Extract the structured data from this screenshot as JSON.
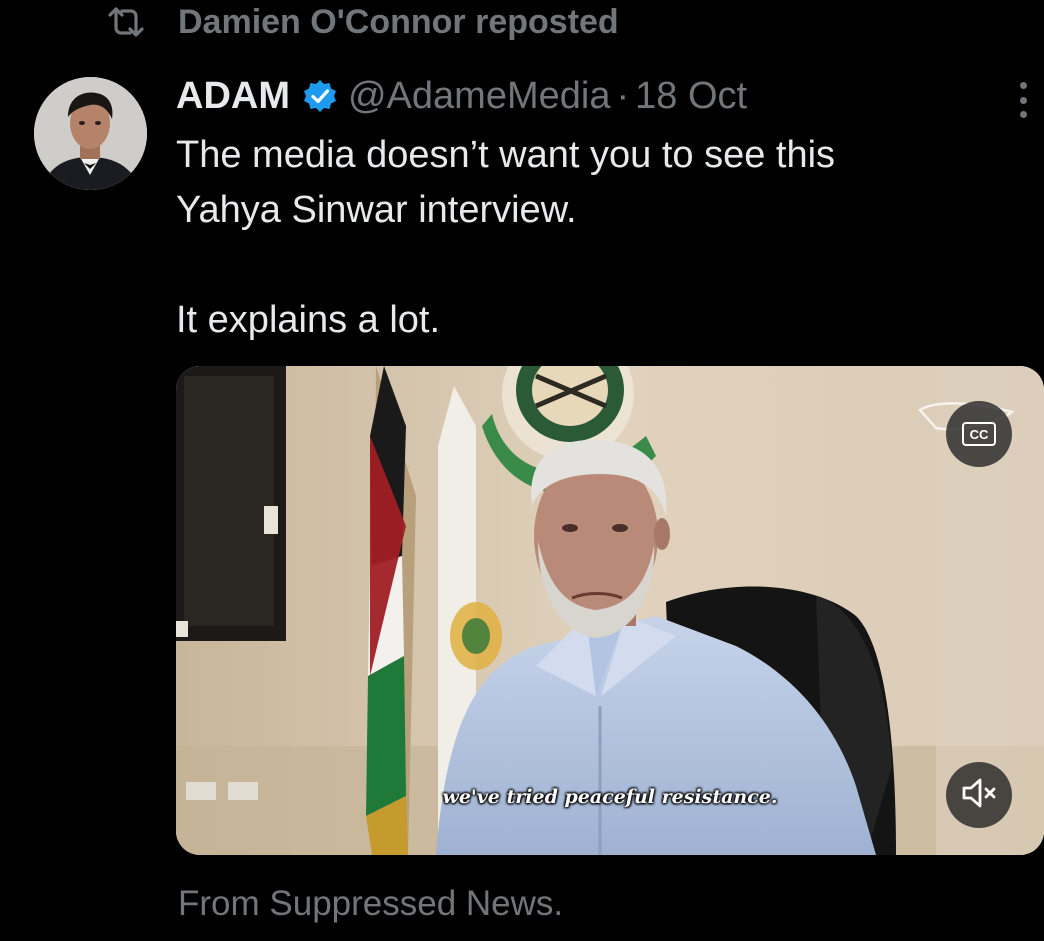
{
  "repost": {
    "icon": "repost-icon",
    "text": "Damien O'Connor reposted"
  },
  "tweet": {
    "avatar_icon": "avatar",
    "author_name": "ADAM",
    "verified_icon": "verified-badge-icon",
    "handle": "@AdameMedia",
    "separator": "·",
    "date": "18 Oct",
    "more_icon": "more-options-icon",
    "text_lines": [
      "The media doesn’t want you to see this",
      "Yahya Sinwar interview.",
      "It explains a lot."
    ]
  },
  "media": {
    "subtitle": "we've tried peaceful resistance.",
    "cc_label": "CC",
    "cc_icon": "captions-icon",
    "mute_icon": "volume-muted-icon"
  },
  "footer": {
    "text": "From Suppressed News."
  },
  "colors": {
    "background": "#000000",
    "primary_text": "#e7e9ea",
    "secondary_text": "#71767b",
    "verified_blue": "#1d9bf0"
  }
}
